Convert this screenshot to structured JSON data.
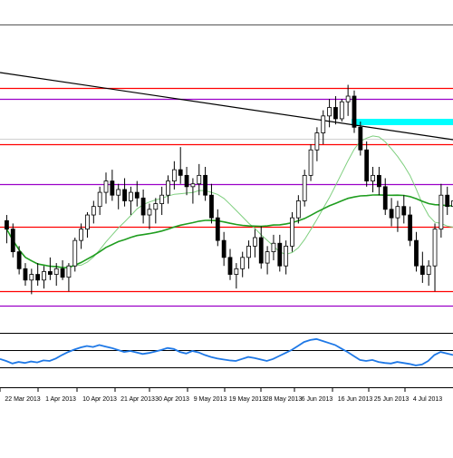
{
  "chart_data": [
    {
      "type": "candlestick",
      "title": "",
      "grid": false,
      "x_tick_labels": [
        "22 Mar 2013",
        "1 Apr 2013",
        "10 Apr 2013",
        "21 Apr 2013",
        "30 Apr 2013",
        "9 May 2013",
        "19 May 2013",
        "28 May 2013",
        "6 Jun 2013",
        "16 Jun 2013",
        "25 Jun 2013",
        "4 Jul 2013"
      ],
      "horizontal_levels": [
        {
          "color": "#ff0000",
          "level": 0.78
        },
        {
          "color": "#9b00c8",
          "level": 0.74
        },
        {
          "color": "#ff0000",
          "level": 0.58
        },
        {
          "color": "#9b00c8",
          "level": 0.44
        },
        {
          "color": "#ff0000",
          "level": 0.29
        },
        {
          "color": "#ff0000",
          "level": 0.06
        },
        {
          "color": "#9b00c8",
          "level": 0.01
        }
      ],
      "trendline_color": "#000000",
      "highlight_zone_color": "#00ffff",
      "ma_long_color": "#1f9d1f",
      "ma_short_color": "#7fcf7f",
      "candles": [
        {
          "o": 0.31,
          "h": 0.33,
          "l": 0.23,
          "c": 0.28
        },
        {
          "o": 0.28,
          "h": 0.3,
          "l": 0.18,
          "c": 0.2
        },
        {
          "o": 0.2,
          "h": 0.22,
          "l": 0.12,
          "c": 0.14
        },
        {
          "o": 0.14,
          "h": 0.16,
          "l": 0.08,
          "c": 0.1
        },
        {
          "o": 0.1,
          "h": 0.14,
          "l": 0.05,
          "c": 0.12
        },
        {
          "o": 0.12,
          "h": 0.16,
          "l": 0.08,
          "c": 0.1
        },
        {
          "o": 0.1,
          "h": 0.15,
          "l": 0.07,
          "c": 0.13
        },
        {
          "o": 0.13,
          "h": 0.18,
          "l": 0.1,
          "c": 0.12
        },
        {
          "o": 0.12,
          "h": 0.16,
          "l": 0.08,
          "c": 0.14
        },
        {
          "o": 0.14,
          "h": 0.17,
          "l": 0.1,
          "c": 0.11
        },
        {
          "o": 0.11,
          "h": 0.16,
          "l": 0.06,
          "c": 0.15
        },
        {
          "o": 0.15,
          "h": 0.25,
          "l": 0.13,
          "c": 0.24
        },
        {
          "o": 0.24,
          "h": 0.3,
          "l": 0.21,
          "c": 0.28
        },
        {
          "o": 0.28,
          "h": 0.34,
          "l": 0.25,
          "c": 0.33
        },
        {
          "o": 0.33,
          "h": 0.38,
          "l": 0.3,
          "c": 0.36
        },
        {
          "o": 0.36,
          "h": 0.43,
          "l": 0.33,
          "c": 0.41
        },
        {
          "o": 0.41,
          "h": 0.48,
          "l": 0.37,
          "c": 0.45
        },
        {
          "o": 0.45,
          "h": 0.49,
          "l": 0.38,
          "c": 0.4
        },
        {
          "o": 0.4,
          "h": 0.44,
          "l": 0.35,
          "c": 0.42
        },
        {
          "o": 0.42,
          "h": 0.46,
          "l": 0.36,
          "c": 0.38
        },
        {
          "o": 0.38,
          "h": 0.43,
          "l": 0.33,
          "c": 0.41
        },
        {
          "o": 0.41,
          "h": 0.45,
          "l": 0.36,
          "c": 0.39
        },
        {
          "o": 0.39,
          "h": 0.42,
          "l": 0.3,
          "c": 0.33
        },
        {
          "o": 0.33,
          "h": 0.37,
          "l": 0.28,
          "c": 0.35
        },
        {
          "o": 0.35,
          "h": 0.39,
          "l": 0.3,
          "c": 0.37
        },
        {
          "o": 0.37,
          "h": 0.43,
          "l": 0.33,
          "c": 0.4
        },
        {
          "o": 0.4,
          "h": 0.47,
          "l": 0.37,
          "c": 0.45
        },
        {
          "o": 0.45,
          "h": 0.52,
          "l": 0.42,
          "c": 0.49
        },
        {
          "o": 0.49,
          "h": 0.57,
          "l": 0.44,
          "c": 0.47
        },
        {
          "o": 0.47,
          "h": 0.5,
          "l": 0.4,
          "c": 0.43
        },
        {
          "o": 0.43,
          "h": 0.46,
          "l": 0.37,
          "c": 0.44
        },
        {
          "o": 0.44,
          "h": 0.51,
          "l": 0.4,
          "c": 0.47
        },
        {
          "o": 0.47,
          "h": 0.5,
          "l": 0.38,
          "c": 0.4
        },
        {
          "o": 0.4,
          "h": 0.44,
          "l": 0.3,
          "c": 0.32
        },
        {
          "o": 0.32,
          "h": 0.35,
          "l": 0.22,
          "c": 0.24
        },
        {
          "o": 0.24,
          "h": 0.27,
          "l": 0.15,
          "c": 0.18
        },
        {
          "o": 0.18,
          "h": 0.21,
          "l": 0.1,
          "c": 0.12
        },
        {
          "o": 0.12,
          "h": 0.16,
          "l": 0.07,
          "c": 0.14
        },
        {
          "o": 0.14,
          "h": 0.2,
          "l": 0.11,
          "c": 0.18
        },
        {
          "o": 0.18,
          "h": 0.24,
          "l": 0.14,
          "c": 0.22
        },
        {
          "o": 0.22,
          "h": 0.28,
          "l": 0.18,
          "c": 0.25
        },
        {
          "o": 0.25,
          "h": 0.29,
          "l": 0.14,
          "c": 0.16
        },
        {
          "o": 0.16,
          "h": 0.22,
          "l": 0.12,
          "c": 0.2
        },
        {
          "o": 0.2,
          "h": 0.26,
          "l": 0.17,
          "c": 0.23
        },
        {
          "o": 0.23,
          "h": 0.26,
          "l": 0.13,
          "c": 0.15
        },
        {
          "o": 0.15,
          "h": 0.24,
          "l": 0.12,
          "c": 0.22
        },
        {
          "o": 0.22,
          "h": 0.34,
          "l": 0.2,
          "c": 0.32
        },
        {
          "o": 0.32,
          "h": 0.4,
          "l": 0.3,
          "c": 0.38
        },
        {
          "o": 0.38,
          "h": 0.49,
          "l": 0.36,
          "c": 0.47
        },
        {
          "o": 0.47,
          "h": 0.58,
          "l": 0.45,
          "c": 0.56
        },
        {
          "o": 0.56,
          "h": 0.64,
          "l": 0.52,
          "c": 0.62
        },
        {
          "o": 0.62,
          "h": 0.7,
          "l": 0.58,
          "c": 0.68
        },
        {
          "o": 0.68,
          "h": 0.74,
          "l": 0.64,
          "c": 0.71
        },
        {
          "o": 0.71,
          "h": 0.75,
          "l": 0.65,
          "c": 0.67
        },
        {
          "o": 0.67,
          "h": 0.74,
          "l": 0.66,
          "c": 0.73
        },
        {
          "o": 0.73,
          "h": 0.79,
          "l": 0.68,
          "c": 0.75
        },
        {
          "o": 0.75,
          "h": 0.77,
          "l": 0.62,
          "c": 0.64
        },
        {
          "o": 0.64,
          "h": 0.66,
          "l": 0.54,
          "c": 0.56
        },
        {
          "o": 0.56,
          "h": 0.59,
          "l": 0.43,
          "c": 0.45
        },
        {
          "o": 0.45,
          "h": 0.5,
          "l": 0.41,
          "c": 0.47
        },
        {
          "o": 0.47,
          "h": 0.5,
          "l": 0.4,
          "c": 0.43
        },
        {
          "o": 0.43,
          "h": 0.46,
          "l": 0.33,
          "c": 0.35
        },
        {
          "o": 0.35,
          "h": 0.39,
          "l": 0.29,
          "c": 0.32
        },
        {
          "o": 0.32,
          "h": 0.38,
          "l": 0.27,
          "c": 0.36
        },
        {
          "o": 0.36,
          "h": 0.4,
          "l": 0.3,
          "c": 0.33
        },
        {
          "o": 0.33,
          "h": 0.36,
          "l": 0.22,
          "c": 0.24
        },
        {
          "o": 0.24,
          "h": 0.27,
          "l": 0.13,
          "c": 0.15
        },
        {
          "o": 0.15,
          "h": 0.2,
          "l": 0.09,
          "c": 0.12
        },
        {
          "o": 0.12,
          "h": 0.17,
          "l": 0.08,
          "c": 0.15
        },
        {
          "o": 0.15,
          "h": 0.3,
          "l": 0.06,
          "c": 0.28
        },
        {
          "o": 0.28,
          "h": 0.44,
          "l": 0.25,
          "c": 0.4
        },
        {
          "o": 0.4,
          "h": 0.43,
          "l": 0.33,
          "c": 0.36
        },
        {
          "o": 0.36,
          "h": 0.4,
          "l": 0.32,
          "c": 0.38
        }
      ]
    },
    {
      "type": "line",
      "title": "",
      "series": [
        {
          "color": "#1e78e6",
          "values": [
            44,
            40,
            35,
            38,
            36,
            39,
            37,
            41,
            40,
            45,
            52,
            58,
            63,
            67,
            70,
            68,
            72,
            69,
            66,
            62,
            58,
            60,
            57,
            54,
            56,
            59,
            62,
            66,
            64,
            58,
            55,
            60,
            57,
            52,
            48,
            45,
            43,
            41,
            40,
            44,
            48,
            46,
            43,
            40,
            44,
            50,
            56,
            62,
            70,
            78,
            82,
            84,
            80,
            76,
            72,
            65,
            58,
            50,
            42,
            40,
            42,
            38,
            36,
            35,
            38,
            36,
            34,
            31,
            33,
            40,
            52,
            58,
            55,
            52
          ]
        }
      ]
    }
  ]
}
